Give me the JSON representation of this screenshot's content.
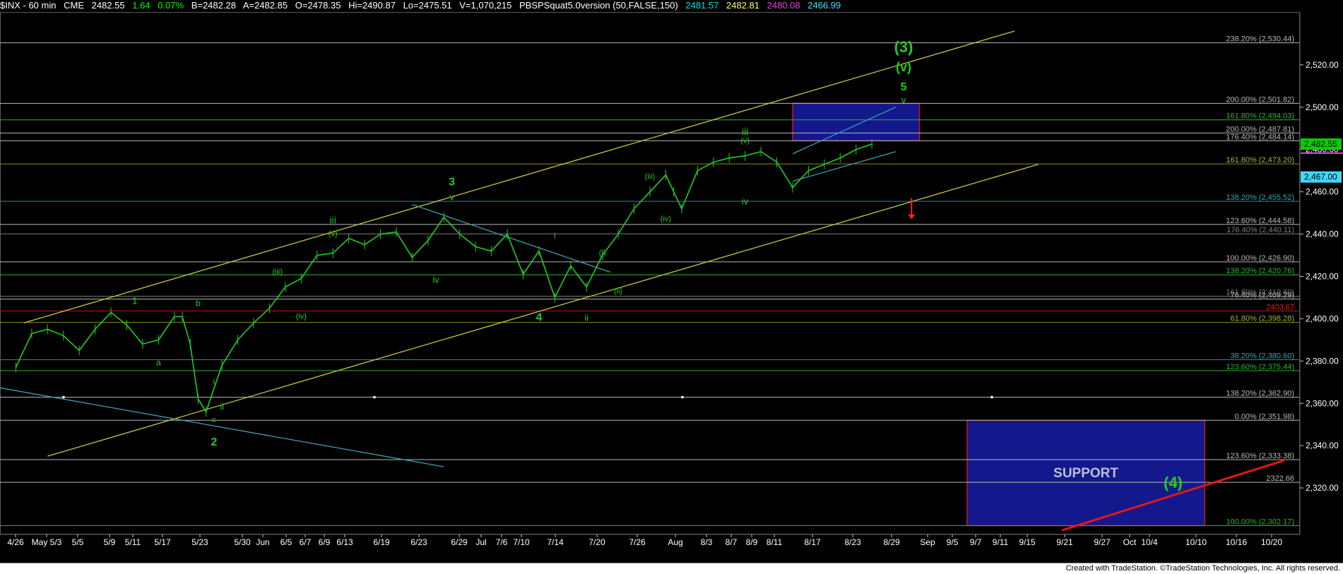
{
  "header": {
    "symbol": "$INX - 60 min",
    "exchange": "CME",
    "last": "2482.55",
    "change": "1.64",
    "change_pct": "0.07%",
    "bid": "B=2482.28",
    "ask": "A=2482.85",
    "open": "O=2478.35",
    "high": "Hi=2490.87",
    "low": "Lo=2475.51",
    "volume": "V=1,070,215",
    "indicator": "PBSPSquat5.0version (50,FALSE,150)",
    "ind_values": [
      {
        "text": "2481.57",
        "color": "#00e0e0"
      },
      {
        "text": "2482.81",
        "color": "#ffff66"
      },
      {
        "text": "2480.08",
        "color": "#e040e0"
      },
      {
        "text": "2466.99",
        "color": "#40e0ff"
      }
    ]
  },
  "footer": {
    "credit": "Created with TradeStation. ©TradeStation Technologies, Inc. All rights reserved."
  },
  "chart_data": {
    "type": "line",
    "symbol": "$INX",
    "interval": "60 min",
    "ylim": [
      2298,
      2545
    ],
    "y_ticks": [
      2320,
      2340,
      2360,
      2380,
      2400,
      2420,
      2440,
      2460,
      2480,
      2500,
      2520
    ],
    "x_tick_labels": [
      "4/26",
      "May 5/3",
      "5/5",
      "5/9",
      "5/11",
      "5/17",
      "5/23",
      "5/30",
      "Jun",
      "6/5",
      "6/7",
      "6/9",
      "6/13",
      "6/19",
      "6/23",
      "6/29",
      "Jul",
      "7/6",
      "7/10",
      "7/14",
      "7/20",
      "7/26",
      "Aug",
      "8/3",
      "8/7",
      "8/9",
      "8/11",
      "8/17",
      "8/23",
      "8/29",
      "Sep",
      "9/5",
      "9/7",
      "9/11",
      "9/15",
      "9/21",
      "9/27",
      "Oct",
      "10/4",
      "10/10",
      "10/16",
      "10/20"
    ],
    "price_series": {
      "name": "$INX",
      "t": [
        0,
        2,
        4,
        6,
        8,
        10,
        12,
        14,
        16,
        18,
        20,
        21,
        22,
        23,
        24,
        26,
        28,
        30,
        32,
        34,
        36,
        38,
        40,
        42,
        44,
        46,
        48,
        50,
        52,
        54,
        56,
        58,
        60,
        62,
        64,
        66,
        68,
        70,
        72,
        74,
        76,
        78,
        80,
        82,
        83,
        84,
        86,
        88,
        90,
        92,
        94,
        96,
        98,
        100,
        102,
        104,
        106,
        108
      ],
      "close": [
        2377,
        2393,
        2395,
        2392,
        2385,
        2395,
        2403,
        2397,
        2388,
        2390,
        2401,
        2401,
        2388,
        2362,
        2356,
        2378,
        2390,
        2398,
        2405,
        2415,
        2419,
        2430,
        2431,
        2438,
        2435,
        2440,
        2441,
        2429,
        2437,
        2448,
        2440,
        2434,
        2432,
        2440,
        2421,
        2432,
        2410,
        2425,
        2415,
        2430,
        2440,
        2452,
        2460,
        2468,
        2460,
        2452,
        2470,
        2474,
        2476,
        2477,
        2479,
        2474,
        2462,
        2470,
        2473,
        2476,
        2480,
        2482.55
      ],
      "line_color": "#22cc22"
    },
    "current_price": "2,482.55",
    "lower_price_tag": "2,467.00",
    "fib_levels": [
      {
        "label": "238.20% (2,530.44)",
        "value": 2530.44,
        "color": "#b8b8b8",
        "label_color": "#b8b8b8"
      },
      {
        "label": "200.00% (2,501.82)",
        "value": 2501.82,
        "color": "#b8b8b8",
        "label_color": "#b8b8b8"
      },
      {
        "label": "161.80% (2,494.03)",
        "value": 2494.03,
        "color": "#2cb52c",
        "label_color": "#2cb52c"
      },
      {
        "label": "200.00% (2,487.81)",
        "value": 2487.81,
        "color": "#b8b8b8",
        "label_color": "#b8b8b8"
      },
      {
        "label": "176.40% (2,484.14)",
        "value": 2484.14,
        "color": "#b8b8b8",
        "label_color": "#b8b8b8"
      },
      {
        "label": "161.80% (2,473.20)",
        "value": 2473.2,
        "color": "#8c8c20",
        "label_color": "#b0b040"
      },
      {
        "label": "138.20% (2,455.52)",
        "value": 2455.52,
        "color": "#2a8c8c",
        "label_color": "#36a8a8"
      },
      {
        "label": "123.60% (2,444.58)",
        "value": 2444.58,
        "color": "#b8b8b8",
        "label_color": "#b8b8b8"
      },
      {
        "label": "176.40% (2,440.11)",
        "value": 2440.11,
        "color": "#7d7d7d",
        "label_color": "#7d7d7d"
      },
      {
        "label": "100.00% (2,426.90)",
        "value": 2426.9,
        "color": "#b8b8b8",
        "label_color": "#b8b8b8"
      },
      {
        "label": "138.20% (2,420.76)",
        "value": 2420.76,
        "color": "#2cb52c",
        "label_color": "#2cb52c"
      },
      {
        "label": "161.80% (2,410.60)",
        "value": 2410.6,
        "color": "#7d7d7d",
        "label_color": "#7d7d7d"
      },
      {
        "label": "76.40% (2,409.29)",
        "value": 2409.29,
        "color": "#b8b8b8",
        "label_color": "#b8b8b8"
      },
      {
        "label": "2403.67",
        "value": 2403.67,
        "color": "#c01818",
        "label_color": "#e02020"
      },
      {
        "label": "61.80% (2,398.28)",
        "value": 2398.28,
        "color": "#8c8c20",
        "label_color": "#b0b040"
      },
      {
        "label": "38.20% (2,380.60)",
        "value": 2380.6,
        "color": "#2a8c8c",
        "label_color": "#36a8a8"
      },
      {
        "label": "123.60% (2,375.44)",
        "value": 2375.44,
        "color": "#2cb52c",
        "label_color": "#2cb52c"
      },
      {
        "label": "138.20% (2,362.90)",
        "value": 2362.9,
        "color": "#b8b8b8",
        "label_color": "#b8b8b8"
      },
      {
        "label": "0.00% (2,351.98)",
        "value": 2351.98,
        "color": "#b8b8b8",
        "label_color": "#b8b8b8"
      },
      {
        "label": "123.60% (2,333.38)",
        "value": 2333.38,
        "color": "#b8b8b8",
        "label_color": "#b8b8b8"
      },
      {
        "label": "2322.66",
        "value": 2322.66,
        "color": "#b8b8b8",
        "label_color": "#b8b8b8"
      },
      {
        "label": "100.00% (2,302.17)",
        "value": 2302.17,
        "color": "#2cb52c",
        "label_color": "#2cb52c"
      }
    ],
    "target_box": {
      "t0": 98,
      "t1": 114,
      "y0": 2484.14,
      "y1": 2501.82,
      "fill": "#13188c",
      "stroke": "#c01818"
    },
    "support_box": {
      "t0": 120,
      "t1": 150,
      "y0": 2302.17,
      "y1": 2351.98,
      "fill": "#13188c",
      "stroke": "#c01818",
      "label": "SUPPORT"
    },
    "channel_lines": [
      {
        "name": "upper yellow channel",
        "t": [
          1,
          126
        ],
        "y": [
          2398,
          2536
        ],
        "color": "#c8c840"
      },
      {
        "name": "lower yellow channel",
        "t": [
          4,
          129
        ],
        "y": [
          2335,
          2473
        ],
        "color": "#c8c840"
      },
      {
        "name": "blue downtrend 1",
        "t": [
          -6,
          54
        ],
        "y": [
          2370,
          2330
        ],
        "color": "#3aa0b0"
      },
      {
        "name": "blue downtrend 2",
        "t": [
          50,
          75
        ],
        "y": [
          2454,
          2422
        ],
        "color": "#3aa0b0"
      },
      {
        "name": "wedge upper",
        "t": [
          98,
          111
        ],
        "y": [
          2478,
          2500
        ],
        "color": "#3aa0b0"
      },
      {
        "name": "wedge lower",
        "t": [
          98,
          111
        ],
        "y": [
          2465,
          2479
        ],
        "color": "#3aa0b0"
      },
      {
        "name": "red support trendline",
        "t": [
          132,
          160
        ],
        "y": [
          2300,
          2333
        ],
        "color": "#e01818"
      }
    ],
    "wave_labels": [
      {
        "text": "(3)",
        "t": 112,
        "y": 2526,
        "size": 22,
        "color": "#22cc22"
      },
      {
        "text": "(v)",
        "t": 112,
        "y": 2517,
        "size": 18,
        "color": "#22cc22"
      },
      {
        "text": "5",
        "t": 112,
        "y": 2508,
        "size": 16,
        "color": "#22cc22"
      },
      {
        "text": "v",
        "t": 112,
        "y": 2502,
        "size": 13,
        "color": "#22cc22"
      },
      {
        "text": "iii",
        "t": 92,
        "y": 2487,
        "size": 14,
        "color": "#22cc22"
      },
      {
        "text": "(v)",
        "t": 92,
        "y": 2483,
        "size": 11,
        "color": "#22cc22"
      },
      {
        "text": "iv",
        "t": 92,
        "y": 2454,
        "size": 13,
        "color": "#22cc22"
      },
      {
        "text": "(iii)",
        "t": 80,
        "y": 2466,
        "size": 11,
        "color": "#22cc22"
      },
      {
        "text": "(iv)",
        "t": 82,
        "y": 2446,
        "size": 11,
        "color": "#22cc22"
      },
      {
        "text": "3",
        "t": 55,
        "y": 2463,
        "size": 16,
        "color": "#22cc22"
      },
      {
        "text": "v",
        "t": 55,
        "y": 2456,
        "size": 13,
        "color": "#22cc22"
      },
      {
        "text": "iii",
        "t": 40,
        "y": 2445,
        "size": 14,
        "color": "#22cc22"
      },
      {
        "text": "(v)",
        "t": 40,
        "y": 2439,
        "size": 11,
        "color": "#22cc22"
      },
      {
        "text": "iv",
        "t": 53,
        "y": 2417,
        "size": 13,
        "color": "#22cc22"
      },
      {
        "text": "(iii)",
        "t": 33,
        "y": 2421,
        "size": 11,
        "color": "#22cc22"
      },
      {
        "text": "(iv)",
        "t": 36,
        "y": 2400,
        "size": 11,
        "color": "#22cc22"
      },
      {
        "text": "4",
        "t": 66,
        "y": 2399,
        "size": 16,
        "color": "#22cc22"
      },
      {
        "text": "ii",
        "t": 72,
        "y": 2399,
        "size": 13,
        "color": "#22cc22"
      },
      {
        "text": "i",
        "t": 68,
        "y": 2438,
        "size": 12,
        "color": "#22cc22"
      },
      {
        "text": "(i)",
        "t": 74,
        "y": 2430,
        "size": 11,
        "color": "#22cc22"
      },
      {
        "text": "(ii)",
        "t": 76,
        "y": 2412,
        "size": 11,
        "color": "#22cc22"
      },
      {
        "text": "1",
        "t": 15,
        "y": 2407,
        "size": 14,
        "color": "#22cc22"
      },
      {
        "text": "b",
        "t": 23,
        "y": 2406,
        "size": 12,
        "color": "#22cc22"
      },
      {
        "text": "a",
        "t": 18,
        "y": 2378,
        "size": 12,
        "color": "#22cc22"
      },
      {
        "text": "i",
        "t": 25,
        "y": 2369,
        "size": 12,
        "color": "#22cc22"
      },
      {
        "text": "ii",
        "t": 26,
        "y": 2357,
        "size": 13,
        "color": "#22cc22"
      },
      {
        "text": "c",
        "t": 25,
        "y": 2351,
        "size": 11,
        "color": "#22cc22"
      },
      {
        "text": "2",
        "t": 25,
        "y": 2340,
        "size": 16,
        "color": "#22cc22"
      },
      {
        "text": "(4)",
        "t": 146,
        "y": 2320,
        "size": 22,
        "color": "#22cc22"
      }
    ],
    "arrow": {
      "t": 113,
      "y_from": 2457,
      "y_to": 2447,
      "color": "#ff2020"
    }
  }
}
